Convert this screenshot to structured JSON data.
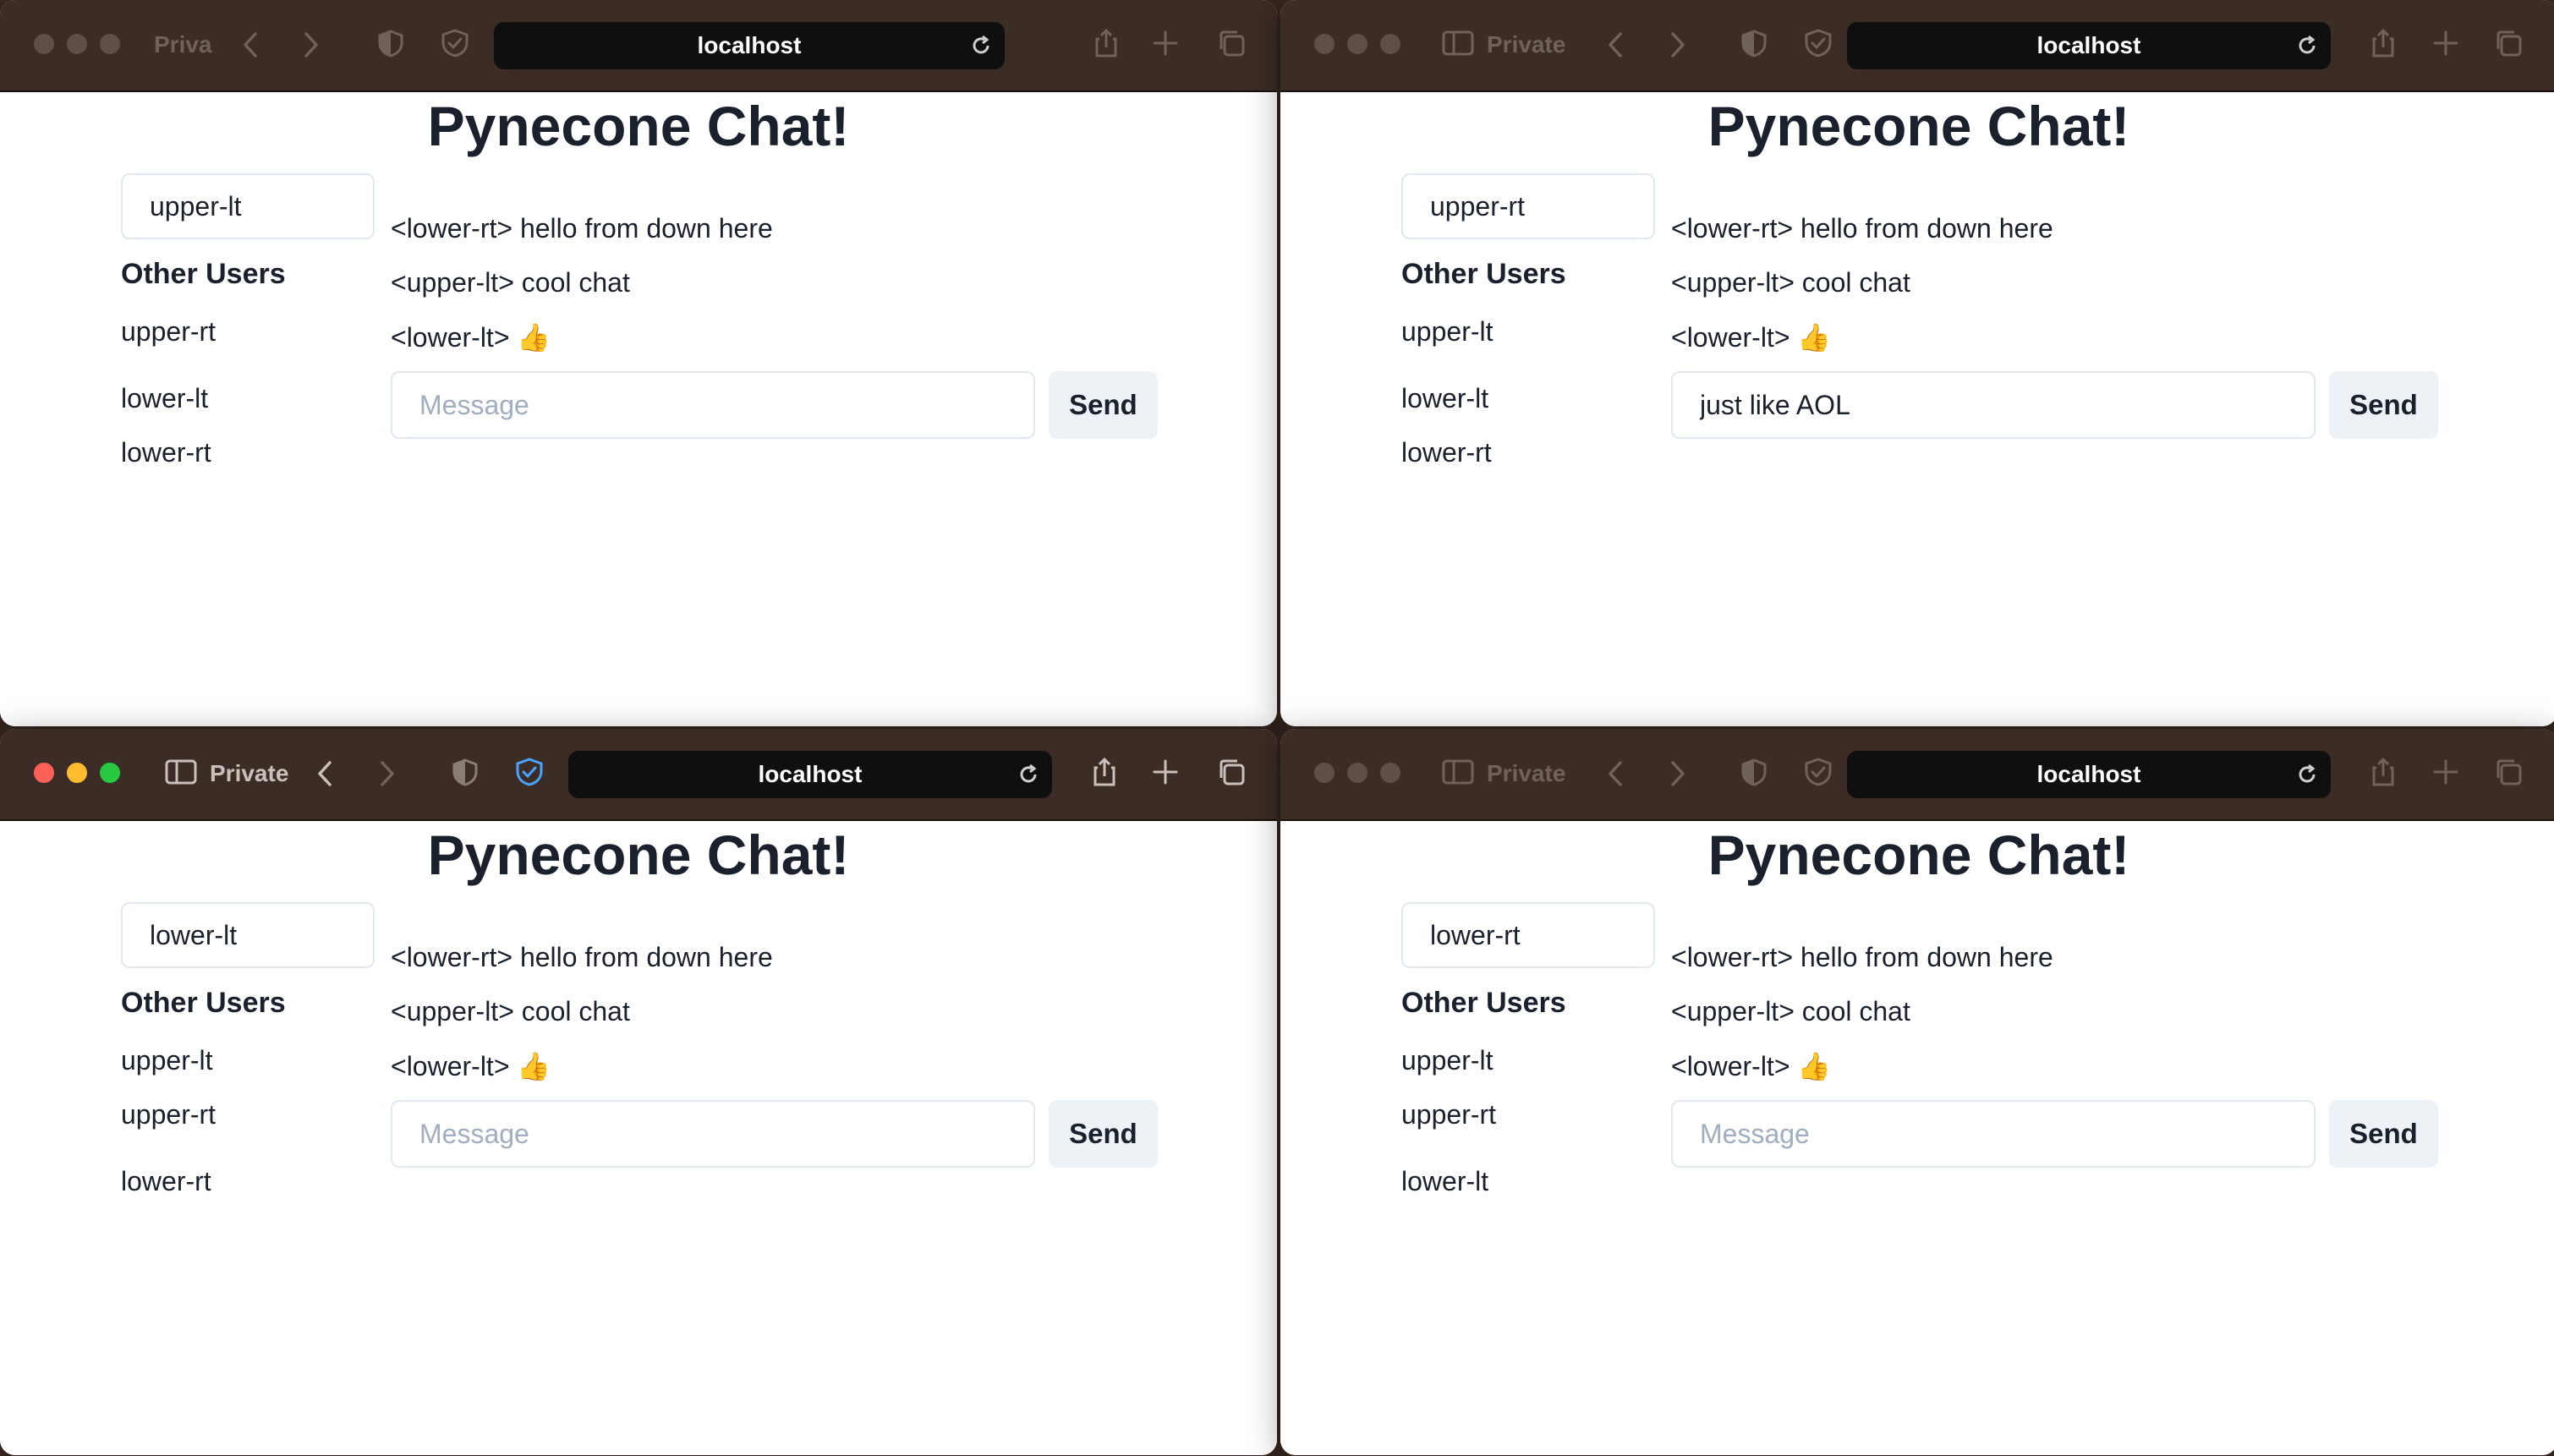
{
  "browser": {
    "url": "localhost",
    "private_label": "Private",
    "private_label_short": "Priva"
  },
  "app": {
    "title": "Pynecone Chat!",
    "other_users_heading": "Other Users",
    "message_placeholder": "Message",
    "send_label": "Send"
  },
  "messages": [
    "<lower-rt> hello from down here",
    "<upper-lt> cool chat",
    "<lower-lt> 👍"
  ],
  "windows": [
    {
      "username": "upper-lt",
      "other_users": [
        "upper-rt",
        "lower-lt",
        "lower-rt"
      ],
      "message_value": "",
      "active": false
    },
    {
      "username": "upper-rt",
      "other_users": [
        "upper-lt",
        "lower-lt",
        "lower-rt"
      ],
      "message_value": "just like AOL",
      "active": false
    },
    {
      "username": "lower-lt",
      "other_users": [
        "upper-lt",
        "upper-rt",
        "lower-rt"
      ],
      "message_value": "",
      "active": true
    },
    {
      "username": "lower-rt",
      "other_users": [
        "upper-lt",
        "upper-rt",
        "lower-lt"
      ],
      "message_value": "",
      "active": false
    }
  ],
  "colors": {
    "toolbar": "#3b2c25",
    "accent_active_shield": "#4aa3ff",
    "send_bg": "#edf2f7",
    "text": "#1a202c",
    "placeholder": "#a0aec0"
  }
}
